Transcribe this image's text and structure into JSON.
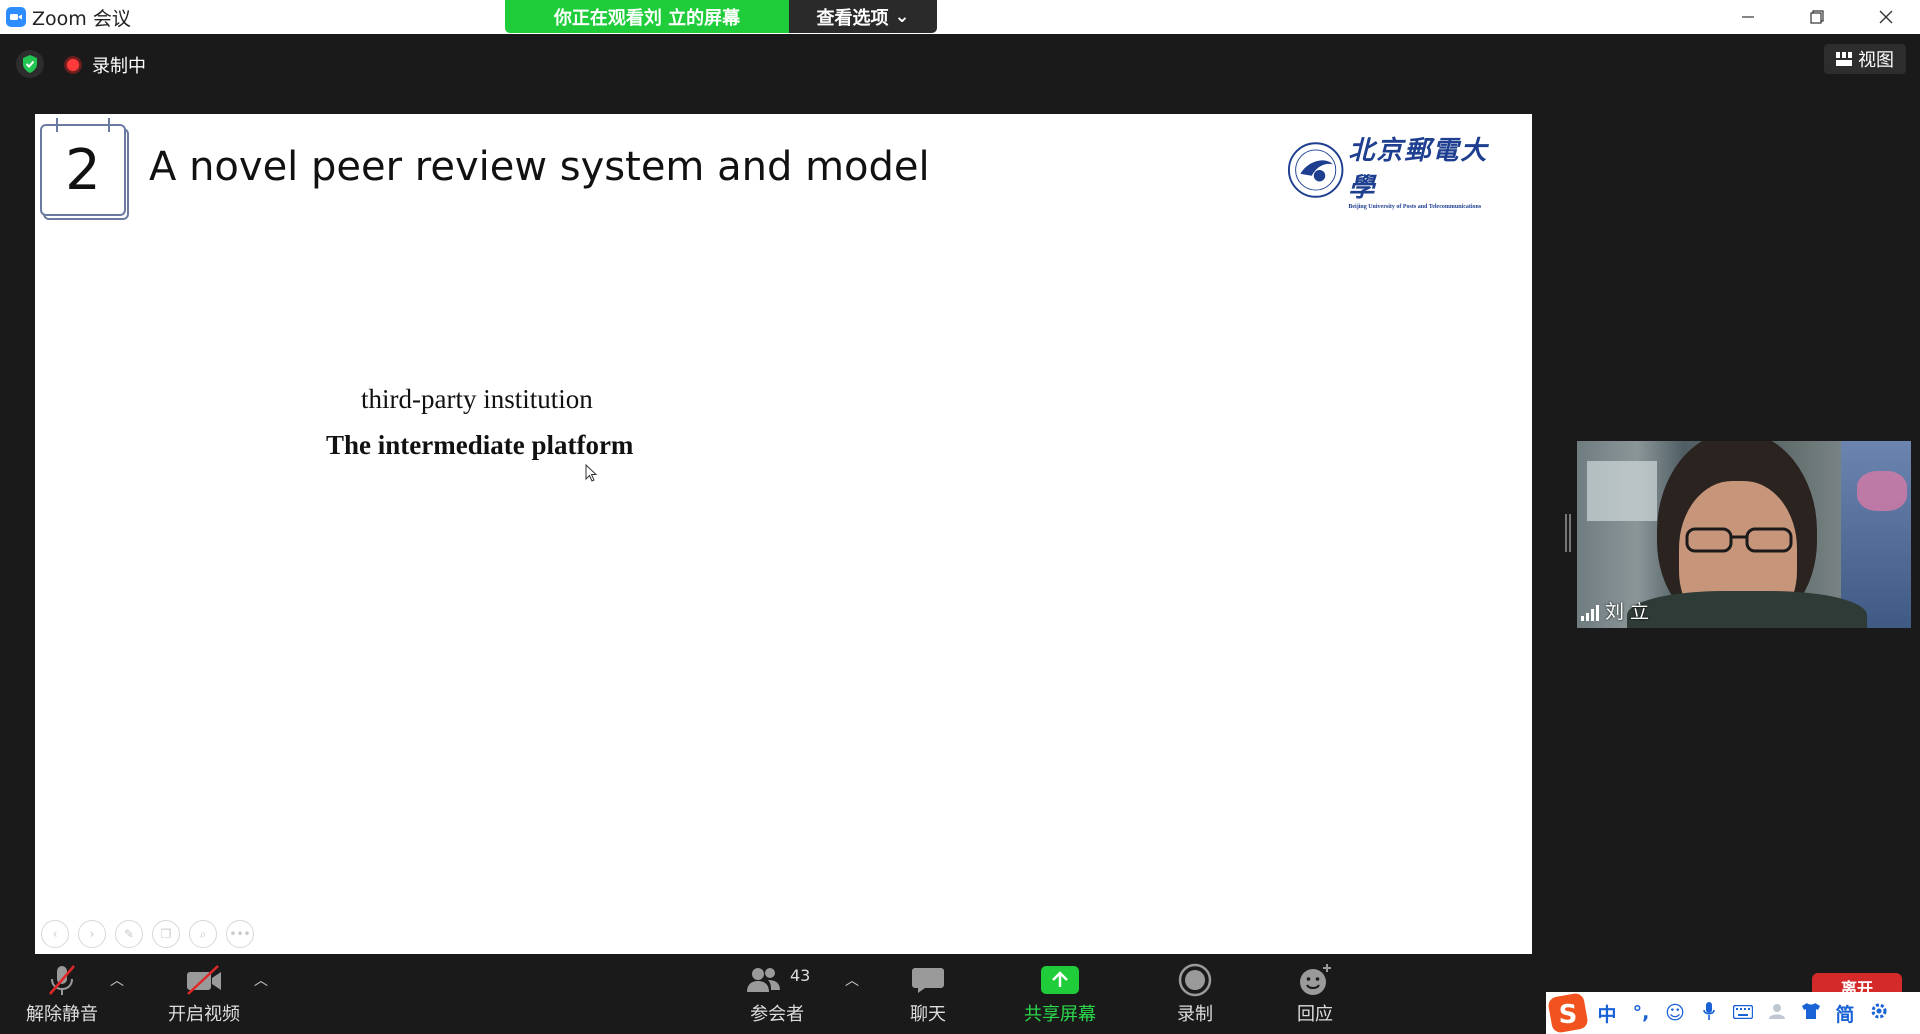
{
  "window": {
    "title": "Zoom 会议",
    "controls": {
      "minimize": "—",
      "restore": "❐",
      "close": "✕"
    }
  },
  "banner": {
    "viewing_text": "你正在观看刘 立的屏幕",
    "options_label": "查看选项"
  },
  "topbar": {
    "recording_label": "录制中",
    "view_label": "视图"
  },
  "slide": {
    "number": "2",
    "title": "A novel peer review system and model",
    "logo_cn": "北京郵電大學",
    "logo_en": "Beijing University of Posts and Telecommunications",
    "line1": "third-party institution",
    "line2": "The intermediate platform",
    "annotation_tools": [
      "prev-icon",
      "next-icon",
      "pen-icon",
      "copy-icon",
      "zoom-icon",
      "more-icon"
    ]
  },
  "video": {
    "participant_name": "刘 立"
  },
  "toolbar": {
    "unmute_label": "解除静音",
    "start_video_label": "开启视频",
    "participants_label": "参会者",
    "participants_count": "43",
    "chat_label": "聊天",
    "share_label": "共享屏幕",
    "record_label": "录制",
    "reactions_label": "回应",
    "leave_label": "离开"
  },
  "ime": {
    "items": [
      "中",
      "°,",
      "☺",
      "🎙",
      "⌨",
      "👤",
      "👕",
      "简",
      "⚙"
    ]
  },
  "colors": {
    "zoom_blue": "#2d8cff",
    "banner_green": "#1fcc3a",
    "share_green": "#2bd94b",
    "leave_red": "#d42a2a",
    "logo_blue": "#1e3f8f"
  }
}
